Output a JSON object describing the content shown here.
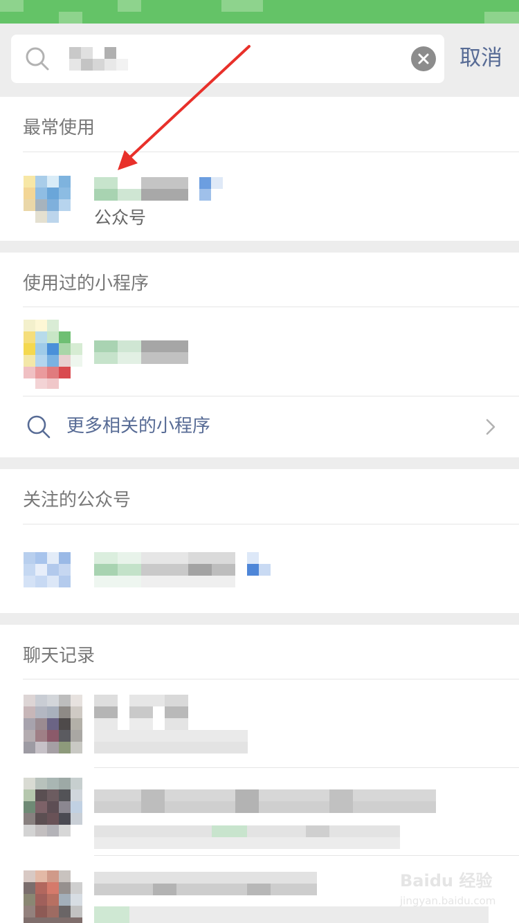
{
  "search": {
    "cancel_label": "取消"
  },
  "sections": {
    "most_used": {
      "title": "最常使用",
      "result_type_label": "公众号"
    },
    "used_mini_programs": {
      "title": "使用过的小程序",
      "more_label": "更多相关的小程序"
    },
    "followed_accounts": {
      "title": "关注的公众号"
    },
    "chat_history": {
      "title": "聊天记录"
    }
  },
  "annotation": {
    "color": "#e8302a"
  },
  "colors": {
    "top_bar": "#64c367",
    "link": "#576b95",
    "gray_bg": "#ededed"
  },
  "watermark": {
    "title": "Baidu 经验",
    "subtitle": "jingyan.baidu.com"
  }
}
